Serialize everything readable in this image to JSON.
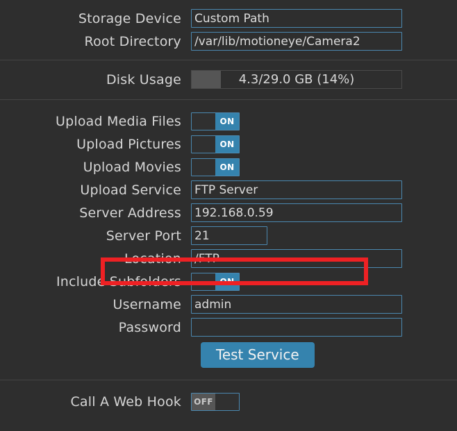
{
  "sections": {
    "storage": {
      "rows": [
        {
          "label": "Storage Device",
          "value": "Custom Path"
        },
        {
          "label": "Root Directory",
          "value": "/var/lib/motioneye/Camera2"
        }
      ]
    },
    "disk": {
      "label": "Disk Usage",
      "value": "4.3/29.0 GB (14%)",
      "percent": 14,
      "used_gb": 4.3,
      "total_gb": 29.0
    },
    "upload": {
      "media_files": {
        "label": "Upload Media Files",
        "state": "ON"
      },
      "pictures": {
        "label": "Upload Pictures",
        "state": "ON"
      },
      "movies": {
        "label": "Upload Movies",
        "state": "ON"
      },
      "service": {
        "label": "Upload Service",
        "value": "FTP Server"
      },
      "server_address": {
        "label": "Server Address",
        "value": "192.168.0.59"
      },
      "server_port": {
        "label": "Server Port",
        "value": "21"
      },
      "location": {
        "label": "Location",
        "value": "/FTP"
      },
      "include_subfolders": {
        "label": "Include Subfolders",
        "state": "ON"
      },
      "username": {
        "label": "Username",
        "value": "admin"
      },
      "password": {
        "label": "Password",
        "value": ""
      },
      "test_button": "Test Service"
    },
    "webhook": {
      "label": "Call A Web Hook",
      "state": "OFF"
    }
  },
  "toggle_labels": {
    "on": "ON",
    "off": "OFF"
  },
  "colors": {
    "accent_blue": "#3583ae",
    "field_border": "#4b88b0",
    "background": "#2e2e2e",
    "annotation_red": "#ee2124",
    "text": "#d6d6d6"
  }
}
